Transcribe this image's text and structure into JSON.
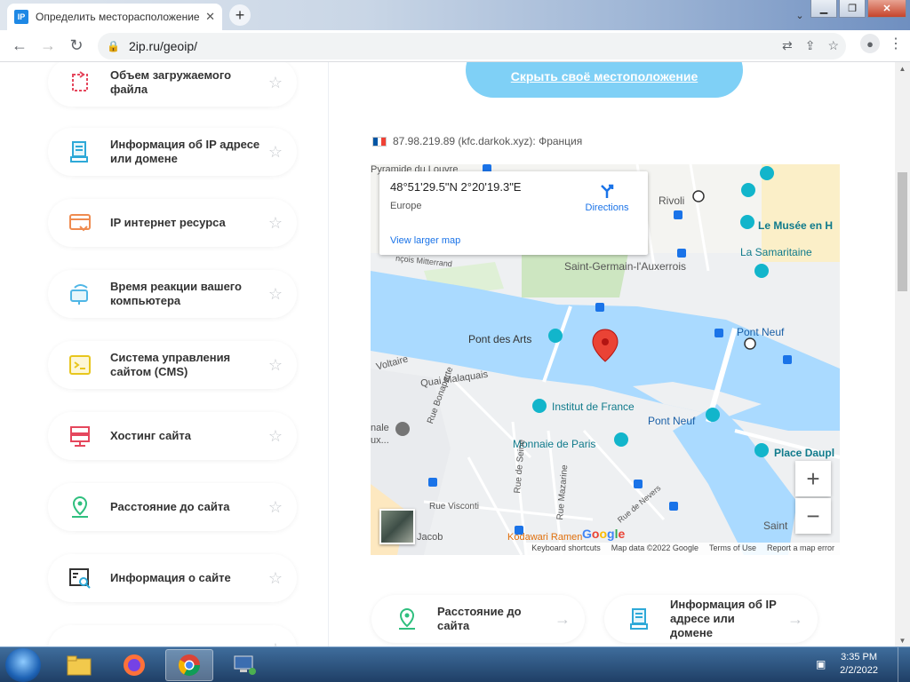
{
  "browser": {
    "tab_title": "Определить месторасположение",
    "favicon_text": "IP",
    "url": "2ip.ru/geoip/"
  },
  "sidebar": {
    "items": [
      {
        "label": "Объем загружаемого файла",
        "icon": "file-size-icon",
        "color": "#e5475d"
      },
      {
        "label": "Информация об IP адресе или домене",
        "icon": "ip-info-icon",
        "color": "#2ea9d8"
      },
      {
        "label": "IP интернет ресурса",
        "icon": "web-resource-icon",
        "color": "#ef8b4f"
      },
      {
        "label": "Время реакции вашего компьютера",
        "icon": "ping-icon",
        "color": "#4fb6e6"
      },
      {
        "label": "Система управления сайтом (CMS)",
        "icon": "cms-icon",
        "color": "#e8c61d"
      },
      {
        "label": "Хостинг сайта",
        "icon": "hosting-icon",
        "color": "#e5475d"
      },
      {
        "label": "Расстояние до сайта",
        "icon": "distance-icon",
        "color": "#2fbf7e"
      },
      {
        "label": "Информация о сайте",
        "icon": "site-info-icon",
        "color": "#333333"
      },
      {
        "label": "",
        "icon": "next-item-icon",
        "color": "#e5475d"
      }
    ]
  },
  "main": {
    "hide_button": "Скрыть своё местоположение",
    "ip_line": "87.98.219.89 (kfc.darkok.xyz): Франция",
    "map": {
      "coords": "48°51'29.5\"N 2°20'19.3\"E",
      "region": "Europe",
      "directions": "Directions",
      "larger_map": "View larger map",
      "labels": [
        "Pyramide du Louvre",
        "Saint-Germain-l'Auxerrois",
        "Le Musée en H",
        "La Samaritaine",
        "Pont des Arts",
        "Pont Neuf",
        "Institut de France",
        "Monnaie de Paris",
        "Place Daupl",
        "Rue Bonaparte",
        "Rue de Seine",
        "Rue Mazarine",
        "Rue Visconti",
        "Quai Malaquais",
        "Voltaire",
        "Jacob",
        "Kodawari Ramen",
        "Rivoli",
        "nçois Mitterrand",
        "nale ux...",
        "Saint",
        "Rue de Nevers",
        "Pont Neuf"
      ],
      "zoom_in": "+",
      "zoom_out": "−",
      "attribution": [
        "Keyboard shortcuts",
        "Map data ©2022 Google",
        "Terms of Use",
        "Report a map error"
      ],
      "google": "Google"
    },
    "bottom_cards": [
      {
        "label": "Расстояние до сайта",
        "icon": "distance-icon"
      },
      {
        "label": "Информация об IP адресе или домене",
        "icon": "ip-info-icon"
      }
    ]
  },
  "taskbar": {
    "time": "3:35 PM",
    "date": "2/2/2022"
  }
}
